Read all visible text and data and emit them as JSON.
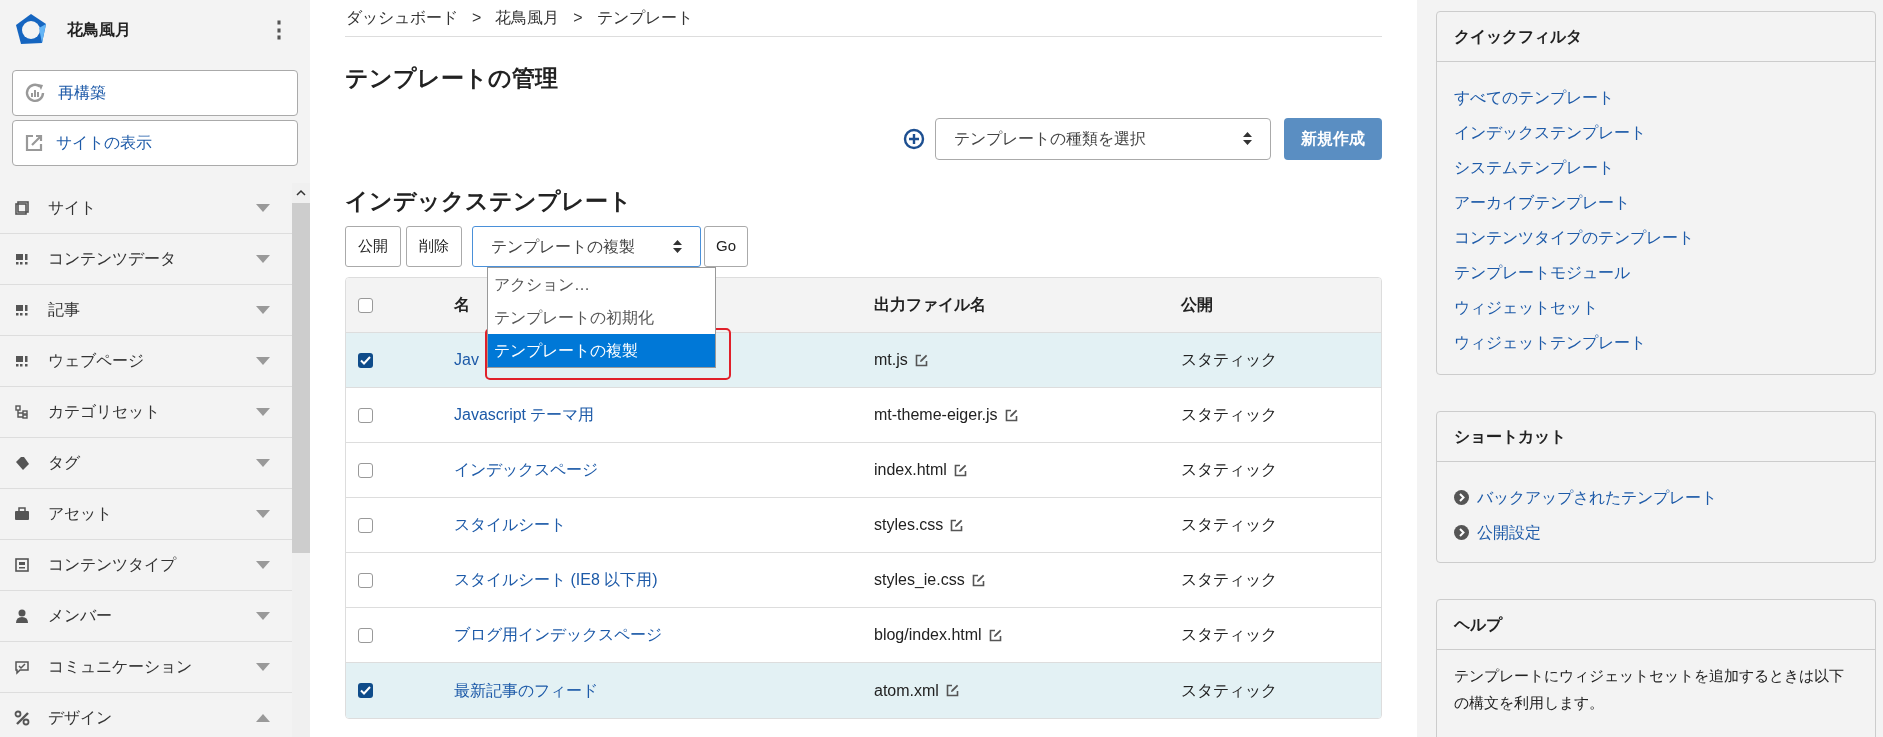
{
  "sidebar": {
    "site_name": "花鳥風月",
    "menu_icon": "⋮",
    "actions": [
      "再構築",
      "サイトの表示"
    ],
    "items": [
      {
        "label": "サイト",
        "expanded": false
      },
      {
        "label": "コンテンツデータ",
        "expanded": false
      },
      {
        "label": "記事",
        "expanded": false
      },
      {
        "label": "ウェブページ",
        "expanded": false
      },
      {
        "label": "カテゴリセット",
        "expanded": false
      },
      {
        "label": "タグ",
        "expanded": false
      },
      {
        "label": "アセット",
        "expanded": false
      },
      {
        "label": "コンテンツタイプ",
        "expanded": false
      },
      {
        "label": "メンバー",
        "expanded": false
      },
      {
        "label": "コミュニケーション",
        "expanded": false
      },
      {
        "label": "デザイン",
        "expanded": true
      }
    ]
  },
  "breadcrumb": [
    "ダッシュボード",
    "花鳥風月",
    "テンプレート"
  ],
  "breadcrumb_separator": ">",
  "page_title": "テンプレートの管理",
  "create": {
    "type_select": "テンプレートの種類を選択",
    "button": "新規作成"
  },
  "section_title": "インデックステンプレート",
  "toolbar": {
    "buttons": [
      "公開",
      "削除"
    ],
    "action_select": "テンプレートの複製",
    "go": "Go",
    "options": [
      {
        "label": "アクション…",
        "selected": false
      },
      {
        "label": "テンプレートの初期化",
        "selected": false
      },
      {
        "label": "テンプレートの複製",
        "selected": true
      }
    ]
  },
  "table": {
    "select_all": false,
    "columns": [
      "名",
      "出力ファイル名",
      "公開"
    ],
    "rows": [
      {
        "name": "Jav",
        "file": "mt.js",
        "publish": "スタティック",
        "checked": true
      },
      {
        "name": "Javascript テーマ用",
        "file": "mt-theme-eiger.js",
        "publish": "スタティック",
        "checked": false
      },
      {
        "name": "インデックスページ",
        "file": "index.html",
        "publish": "スタティック",
        "checked": false
      },
      {
        "name": "スタイルシート",
        "file": "styles.css",
        "publish": "スタティック",
        "checked": false
      },
      {
        "name": "スタイルシート (IE8 以下用)",
        "file": "styles_ie.css",
        "publish": "スタティック",
        "checked": false
      },
      {
        "name": "ブログ用インデックスページ",
        "file": "blog/index.html",
        "publish": "スタティック",
        "checked": false
      },
      {
        "name": "最新記事のフィード",
        "file": "atom.xml",
        "publish": "スタティック",
        "checked": true
      }
    ]
  },
  "quick_filter": {
    "title": "クイックフィルタ",
    "links": [
      "すべてのテンプレート",
      "インデックステンプレート",
      "システムテンプレート",
      "アーカイブテンプレート",
      "コンテンツタイプのテンプレート",
      "テンプレートモジュール",
      "ウィジェットセット",
      "ウィジェットテンプレート"
    ]
  },
  "shortcuts": {
    "title": "ショートカット",
    "links": [
      "バックアップされたテンプレート",
      "公開設定"
    ]
  },
  "help": {
    "title": "ヘルプ",
    "text": "テンプレートにウィジェットセットを追加するときは以下の構文を利用します。"
  }
}
